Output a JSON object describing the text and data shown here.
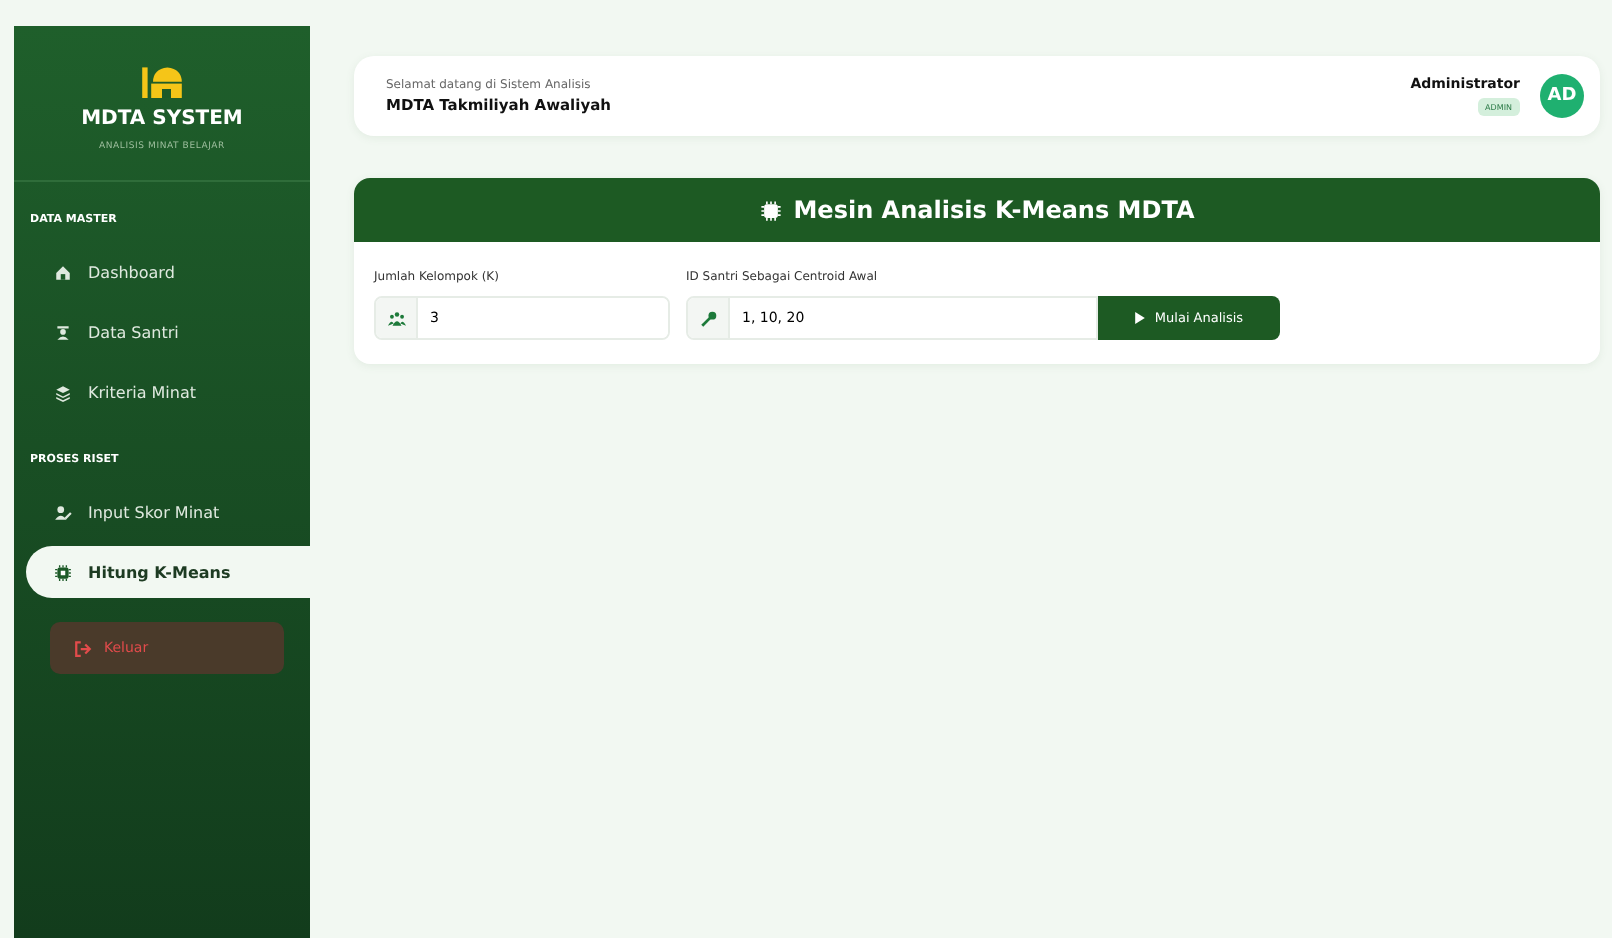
{
  "sidebar": {
    "brand": {
      "title": "MDTA SYSTEM",
      "subtitle": "ANALISIS MINAT BELAJAR"
    },
    "sections": [
      {
        "heading": "DATA MASTER",
        "items": [
          {
            "label": "Dashboard",
            "kind": "house",
            "selected": false
          },
          {
            "label": "Data Santri",
            "kind": "person",
            "selected": false
          },
          {
            "label": "Kriteria Minat",
            "kind": "layers",
            "selected": false
          }
        ]
      },
      {
        "heading": "PROSES RISET",
        "items": [
          {
            "label": "Input Skor Minat",
            "kind": "user",
            "selected": false
          },
          {
            "label": "Hitung K-Means",
            "kind": "chip",
            "selected": true
          }
        ]
      }
    ],
    "logout": "Keluar"
  },
  "header": {
    "greeting": "Selamat datang di Sistem Analisis",
    "school": "MDTA Takmiliyah Awaliyah",
    "user": "Administrator",
    "role": "ADMIN",
    "avatar": "AD"
  },
  "panel": {
    "title": "Mesin Analisis K-Means MDTA",
    "fields": [
      {
        "label": "Jumlah Kelompok (K)",
        "kind": "users",
        "value": "3"
      },
      {
        "label": "ID Santri Sebagai Centroid Awal",
        "kind": "key",
        "value": "1, 10, 20"
      }
    ],
    "button": "Mulai Analisis"
  }
}
